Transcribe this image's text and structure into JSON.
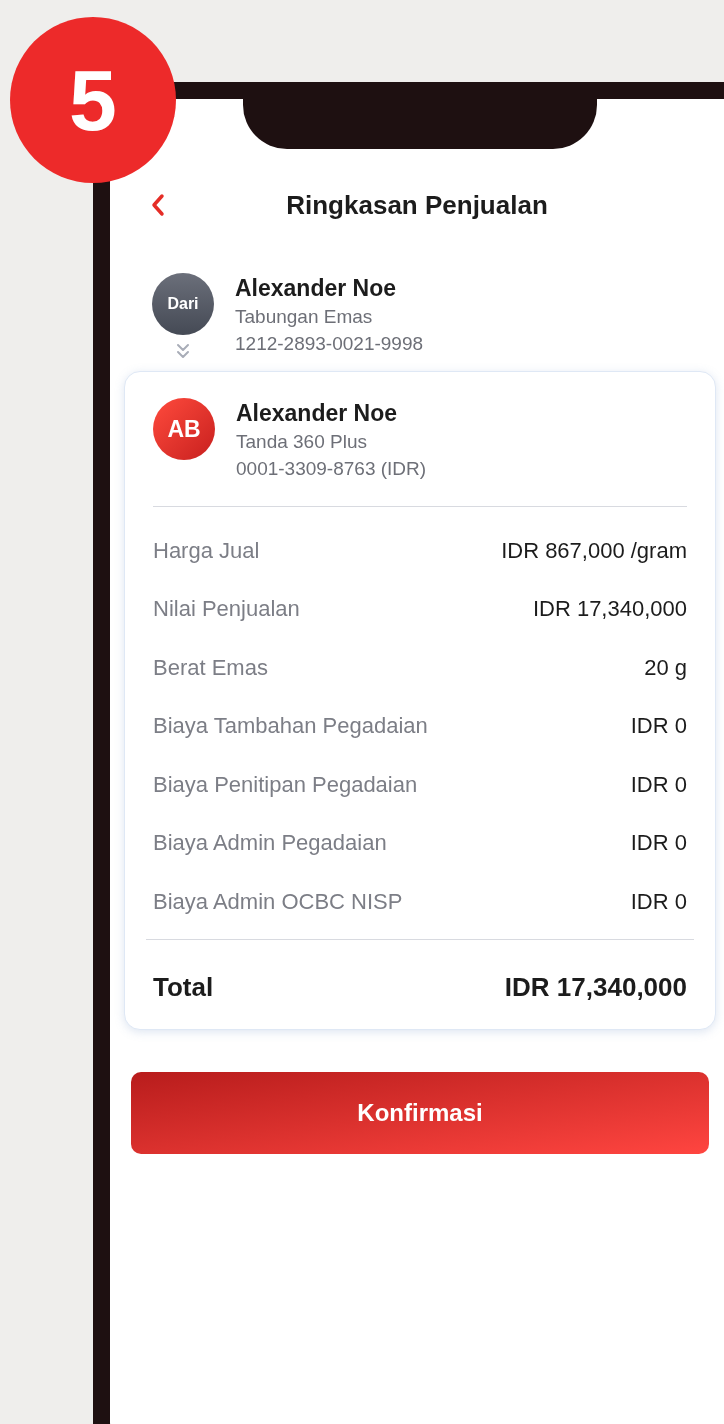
{
  "step_badge": "5",
  "header": {
    "title": "Ringkasan Penjualan"
  },
  "from": {
    "avatar_label": "Dari",
    "name": "Alexander Noe",
    "account_type": "Tabungan Emas",
    "account_number": "1212-2893-0021-9998"
  },
  "to": {
    "avatar_label": "AB",
    "name": "Alexander Noe",
    "account_type": "Tanda 360 Plus",
    "account_number": "0001-3309-8763 (IDR)"
  },
  "details": [
    {
      "label": "Harga Jual",
      "value": "IDR 867,000 /gram"
    },
    {
      "label": "Nilai Penjualan",
      "value": "IDR 17,340,000"
    },
    {
      "label": "Berat Emas",
      "value": "20 g"
    },
    {
      "label": "Biaya Tambahan Pegadaian",
      "value": "IDR 0"
    },
    {
      "label": "Biaya Penitipan Pegadaian",
      "value": "IDR 0"
    },
    {
      "label": "Biaya Admin Pegadaian",
      "value": "IDR 0"
    },
    {
      "label": "Biaya Admin OCBC NISP",
      "value": "IDR 0"
    }
  ],
  "total": {
    "label": "Total",
    "value": "IDR 17,340,000"
  },
  "confirm_button": "Konfirmasi"
}
